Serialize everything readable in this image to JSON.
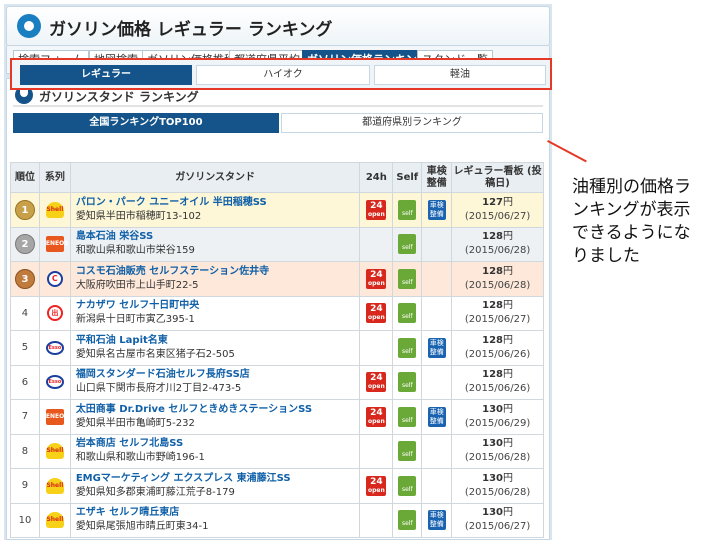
{
  "header": {
    "title": "ガソリン価格 レギュラー ランキング"
  },
  "nav_tabs": [
    {
      "label": "検索フォーム",
      "active": false
    },
    {
      "label": "地図検索",
      "active": false
    },
    {
      "label": "ガソリン価格推移",
      "active": false
    },
    {
      "label": "都道府県平均",
      "active": false
    },
    {
      "label": "ガソリン価格ランキング",
      "active": true
    },
    {
      "label": "スタンド一覧",
      "active": false
    }
  ],
  "panel": {
    "title": "ガソリンスタンド ランキング"
  },
  "scope_tabs": [
    {
      "label": "全国ランキングTOP100",
      "active": true
    },
    {
      "label": "都道府県別ランキング",
      "active": false
    }
  ],
  "fuel_tabs": [
    {
      "label": "レギュラー",
      "active": true
    },
    {
      "label": "ハイオク",
      "active": false
    },
    {
      "label": "軽油",
      "active": false
    }
  ],
  "table": {
    "headers": {
      "rank": "順位",
      "brand": "系列",
      "station": "ガソリンスタンド",
      "h24": "24h",
      "self": "Self",
      "inspection": "車検 整備",
      "price": "レギュラー看板 (投稿日)"
    },
    "rows": [
      {
        "rank": "1",
        "brand": "shell",
        "name": "パロン・パーク ユニーオイル 半田稲穂SS",
        "addr": "愛知県半田市稲穂町13-102",
        "h24": true,
        "self": true,
        "check": true,
        "price": "127",
        "unit": "円",
        "date": "(2015/06/27)"
      },
      {
        "rank": "2",
        "brand": "eneos",
        "name": "島本石油 栄谷SS",
        "addr": "和歌山県和歌山市栄谷159",
        "h24": false,
        "self": true,
        "check": false,
        "price": "128",
        "unit": "円",
        "date": "(2015/06/28)"
      },
      {
        "rank": "3",
        "brand": "cosmo",
        "name": "コスモ石油販売 セルフステーション佐井寺",
        "addr": "大阪府吹田市上山手町22-5",
        "h24": true,
        "self": true,
        "check": false,
        "price": "128",
        "unit": "円",
        "date": "(2015/06/28)"
      },
      {
        "rank": "4",
        "brand": "idemitsu",
        "name": "ナカザワ セルフ十日町中央",
        "addr": "新潟県十日町市寅乙395-1",
        "h24": true,
        "self": true,
        "check": false,
        "price": "128",
        "unit": "円",
        "date": "(2015/06/27)"
      },
      {
        "rank": "5",
        "brand": "esso",
        "name": "平和石油 Lapit名東",
        "addr": "愛知県名古屋市名東区猪子石2-505",
        "h24": false,
        "self": true,
        "check": true,
        "price": "128",
        "unit": "円",
        "date": "(2015/06/26)"
      },
      {
        "rank": "6",
        "brand": "esso",
        "name": "福岡スタンダード石油セルフ長府SS店",
        "addr": "山口県下関市長府才川2丁目2-473-5",
        "h24": true,
        "self": true,
        "check": false,
        "price": "128",
        "unit": "円",
        "date": "(2015/06/26)"
      },
      {
        "rank": "7",
        "brand": "eneos",
        "name": "太田商事 Dr.Drive セルフときめきステーションSS",
        "addr": "愛知県半田市亀崎町5-232",
        "h24": true,
        "self": true,
        "check": true,
        "price": "130",
        "unit": "円",
        "date": "(2015/06/29)"
      },
      {
        "rank": "8",
        "brand": "shell",
        "name": "岩本商店 セルフ北島SS",
        "addr": "和歌山県和歌山市野崎196-1",
        "h24": false,
        "self": true,
        "check": false,
        "price": "130",
        "unit": "円",
        "date": "(2015/06/28)"
      },
      {
        "rank": "9",
        "brand": "shell",
        "name": "EMGマーケティング エクスプレス 東浦藤江SS",
        "addr": "愛知県知多郡東浦町藤江荒子8-179",
        "h24": true,
        "self": true,
        "check": false,
        "price": "130",
        "unit": "円",
        "date": "(2015/06/28)"
      },
      {
        "rank": "10",
        "brand": "shell",
        "name": "エザキ セルフ晴丘東店",
        "addr": "愛知県尾張旭市晴丘町東34-1",
        "h24": false,
        "self": true,
        "check": true,
        "price": "130",
        "unit": "円",
        "date": "(2015/06/27)"
      }
    ]
  },
  "badges": {
    "h24_top": "24",
    "h24_bottom": "open",
    "self": "self",
    "check_top": "車検",
    "check_bottom": "整備"
  },
  "brand_glyphs": {
    "shell": "Shell",
    "eneos": "ENEOS",
    "cosmo": "C",
    "idemitsu": "出",
    "esso": "Esso"
  },
  "callout": {
    "text": "油種別の価格ランキングが表示できるようになりました"
  },
  "colors": {
    "accent": "#14548a",
    "highlight": "#e53826"
  }
}
